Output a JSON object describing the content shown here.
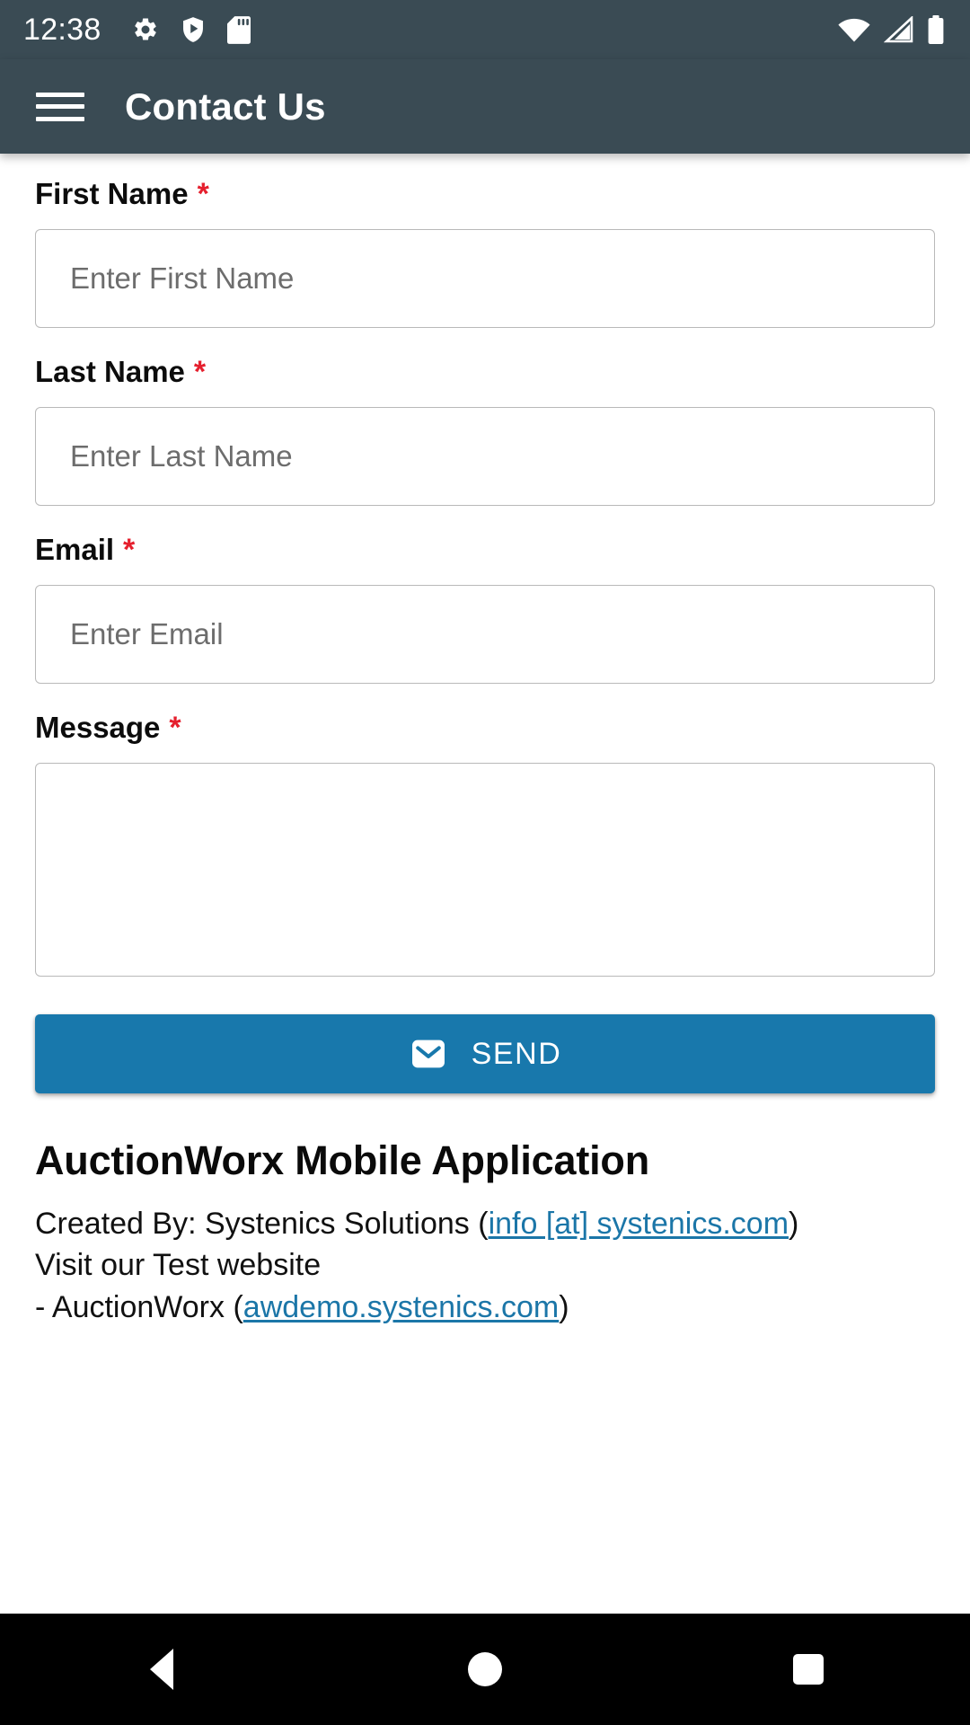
{
  "status_bar": {
    "time": "12:38",
    "left_icons": [
      "gear-icon",
      "shield-play-icon",
      "sd-card-icon"
    ],
    "right_icons": [
      "wifi-icon",
      "cellular-signal-icon",
      "battery-icon"
    ]
  },
  "app_bar": {
    "menu_icon": "hamburger-menu-icon",
    "title": "Contact Us",
    "background_color": "#3a4b54"
  },
  "form": {
    "fields": [
      {
        "label": "First Name",
        "required_marker": "*",
        "placeholder": "Enter First Name",
        "value": "",
        "type": "text"
      },
      {
        "label": "Last Name",
        "required_marker": "*",
        "placeholder": "Enter Last Name",
        "value": "",
        "type": "text"
      },
      {
        "label": "Email",
        "required_marker": "*",
        "placeholder": "Enter Email",
        "value": "",
        "type": "text"
      },
      {
        "label": "Message",
        "required_marker": "*",
        "placeholder": "",
        "value": "",
        "type": "textarea"
      }
    ],
    "send_button": {
      "label": "SEND",
      "icon": "mail-envelope-icon",
      "color": "#1878ac"
    }
  },
  "footer": {
    "title": "AuctionWorx Mobile Application",
    "created_by_prefix": "Created By: Systenics Solutions (",
    "created_by_link": "info [at] systenics.com",
    "created_by_suffix": ")",
    "visit_line": "Visit our Test website",
    "site_prefix": "- AuctionWorx (",
    "site_link": "awdemo.systenics.com",
    "site_suffix": ")",
    "link_color": "#1b76a8"
  },
  "nav_bar": {
    "back_label": "back-button",
    "home_label": "home-button",
    "recents_label": "recents-button"
  }
}
